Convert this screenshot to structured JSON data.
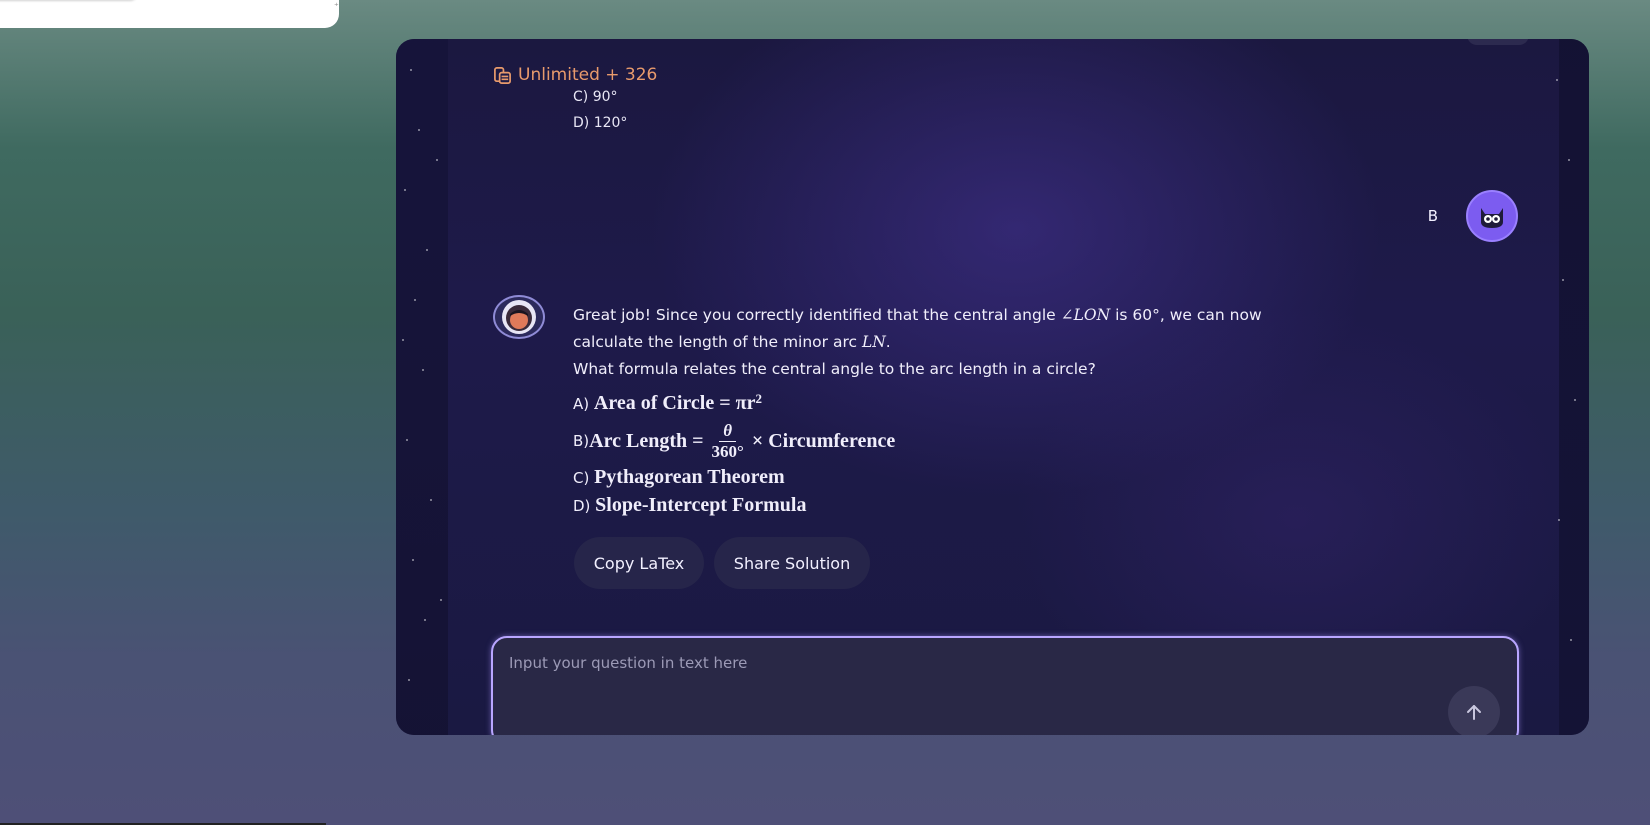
{
  "credits": {
    "text": "Unlimited + 326",
    "color": "#e89a6c",
    "icon": "coins-icon"
  },
  "previous_options": [
    {
      "label": "C) 90°"
    },
    {
      "label": "D) 120°"
    }
  ],
  "user": {
    "label": "B",
    "avatar_icon": "cat-avatar-icon",
    "avatar_color": "#7c5cf0"
  },
  "bot": {
    "avatar_icon": "astronaut-avatar-icon"
  },
  "message": {
    "intro_part1": "Great job! Since you correctly identified that the central angle ",
    "angle": "∠LON",
    "intro_part2": " is 60°, we can now",
    "line2_part1": "calculate the length of the minor arc ",
    "arc": "LN",
    "line2_part2": ".",
    "question": "What formula relates the central angle to the arc length in a circle?",
    "options": [
      {
        "prefix": "A) ",
        "formula": "Area of Circle = πr",
        "sup": "2"
      },
      {
        "prefix": "B) ",
        "formula_left": "Arc Length =",
        "numerator": "θ",
        "denominator": "360°",
        "formula_right": "× Circumference"
      },
      {
        "prefix": "C) ",
        "formula": "Pythagorean Theorem"
      },
      {
        "prefix": "D) ",
        "formula": "Slope-Intercept Formula"
      }
    ]
  },
  "actions": {
    "copy_latex": "Copy LaTex",
    "share_solution": "Share Solution"
  },
  "input": {
    "placeholder": "Input your question in text here",
    "send_icon": "arrow-up-icon"
  }
}
